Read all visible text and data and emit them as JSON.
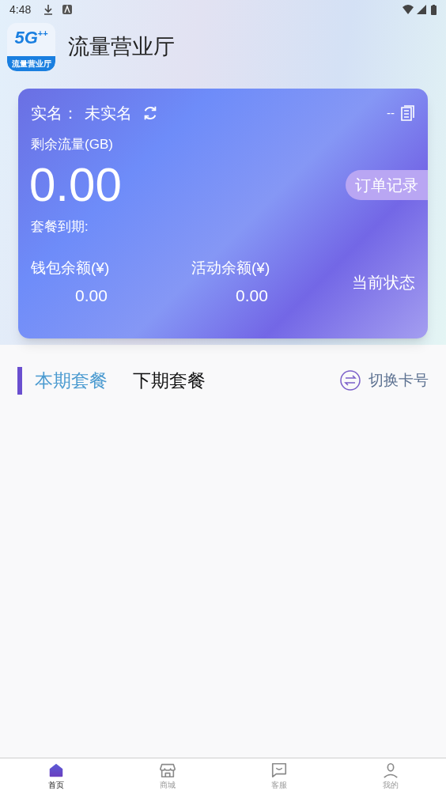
{
  "status_bar": {
    "time": "4:48"
  },
  "header": {
    "logo_mark": "5G",
    "logo_plus": "++",
    "logo_caption": "流量营业厅",
    "title": "流量营业厅"
  },
  "card": {
    "realname_label": "实名：",
    "realname_value": "未实名",
    "number": "--",
    "flow_label": "剩余流量(GB)",
    "flow_value": "0.00",
    "order_button": "订单记录",
    "expiry_label": "套餐到期:",
    "balances": [
      {
        "label": "钱包余额(¥)",
        "value": "0.00"
      },
      {
        "label": "活动余额(¥)",
        "value": "0.00"
      }
    ],
    "status": "当前状态"
  },
  "tabs": [
    {
      "label": "本期套餐",
      "selected": true
    },
    {
      "label": "下期套餐",
      "selected": false
    }
  ],
  "switch_card": "切换卡号",
  "nav": [
    {
      "kind": "home",
      "label": "首页",
      "selected": true
    },
    {
      "kind": "shop",
      "label": "商城",
      "selected": false
    },
    {
      "kind": "service",
      "label": "客服",
      "selected": false
    },
    {
      "kind": "me",
      "label": "我的",
      "selected": false
    }
  ]
}
